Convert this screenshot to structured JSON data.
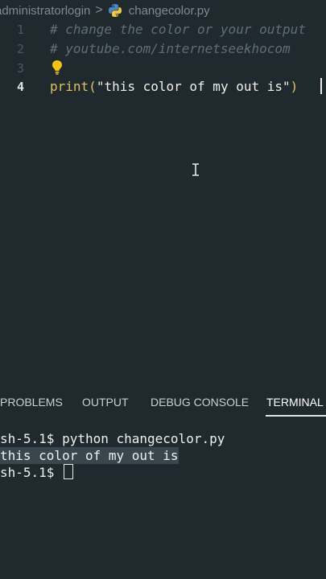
{
  "breadcrumb": {
    "folder": "administratorlogin",
    "separator": ">",
    "file": "changecolor.py"
  },
  "editor": {
    "lines": [
      {
        "num": "1",
        "text": "# change the color or your output"
      },
      {
        "num": "2",
        "text": "# youtube.com/internetseekhocom"
      },
      {
        "num": "3",
        "text": ""
      },
      {
        "num": "4",
        "fn": "print",
        "open": "(",
        "str": "\"this color of my out is\"",
        "close": ")"
      }
    ]
  },
  "panel": {
    "tabs": [
      "PROBLEMS",
      "OUTPUT",
      "DEBUG CONSOLE",
      "TERMINAL"
    ],
    "active_tab": "TERMINAL"
  },
  "terminal": {
    "prompt1": "sh-5.1$ python changecolor.py",
    "output": "this color of my out is",
    "prompt2": "sh-5.1$"
  },
  "colors": {
    "background": "#20292e",
    "comment": "#5e6f77",
    "function": "#e0c060",
    "string": "#f0f0e8"
  },
  "icons": [
    "python-file-icon",
    "lightbulb-icon",
    "text-cursor-icon"
  ]
}
